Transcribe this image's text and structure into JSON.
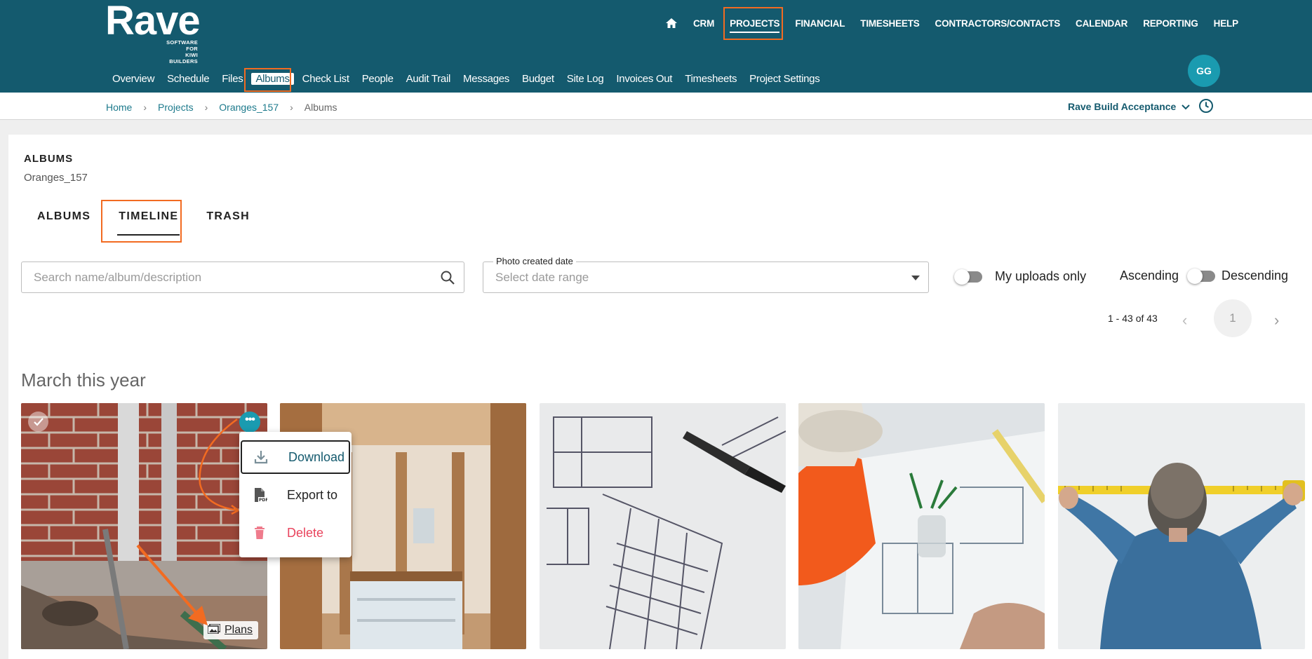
{
  "header": {
    "logo": {
      "word": "Rave",
      "sub": "SOFTWARE FOR\nKIWI BUILDERS"
    },
    "main_nav": [
      "CRM",
      "PROJECTS",
      "FINANCIAL",
      "TIMESHEETS",
      "CONTRACTORS/CONTACTS",
      "CALENDAR",
      "REPORTING",
      "HELP"
    ],
    "active_main": "PROJECTS",
    "sub_nav": [
      "Overview",
      "Schedule",
      "Files",
      "Albums",
      "Check List",
      "People",
      "Audit Trail",
      "Messages",
      "Budget",
      "Site Log",
      "Invoices Out",
      "Timesheets",
      "Project Settings"
    ],
    "active_sub": "Albums",
    "avatar_initials": "GG",
    "accent_color": "#145a6e",
    "highlight_color": "#f26b21"
  },
  "breadcrumb": {
    "items": [
      "Home",
      "Projects",
      "Oranges_157",
      "Albums"
    ],
    "org_selector": "Rave Build Acceptance"
  },
  "page": {
    "title": "ALBUMS",
    "subtitle": "Oranges_157",
    "tabs": [
      "ALBUMS",
      "TIMELINE",
      "TRASH"
    ],
    "active_tab": "TIMELINE"
  },
  "filters": {
    "search_placeholder": "Search name/album/description",
    "date_label": "Photo created date",
    "date_placeholder": "Select date range",
    "my_uploads_label": "My uploads only",
    "ascending_label": "Ascending",
    "descending_label": "Descending"
  },
  "pagination": {
    "range": "1 - 43 of 43",
    "current_page": "1"
  },
  "section_heading": "March this year",
  "photos": [
    {
      "album_tag": "Plans"
    },
    {},
    {},
    {},
    {}
  ],
  "context_menu": {
    "items": [
      {
        "label": "Download",
        "icon": "download-icon"
      },
      {
        "label": "Export to",
        "icon": "pdf-file-icon"
      },
      {
        "label": "Delete",
        "icon": "trash-icon"
      }
    ]
  }
}
